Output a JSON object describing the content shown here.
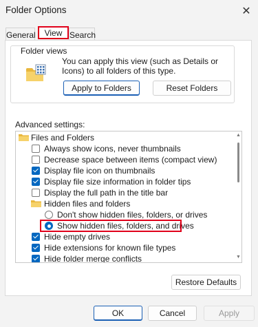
{
  "window": {
    "title": "Folder Options",
    "close_glyph": "✕"
  },
  "tabs": [
    {
      "label": "General"
    },
    {
      "label": "View"
    },
    {
      "label": "Search"
    }
  ],
  "folder_views": {
    "legend": "Folder views",
    "description": "You can apply this view (such as Details or Icons) to all folders of this type.",
    "apply_button": "Apply to Folders",
    "reset_button": "Reset Folders"
  },
  "advanced": {
    "label": "Advanced settings:",
    "items": [
      {
        "type": "folder",
        "label": "Files and Folders"
      },
      {
        "type": "checkbox",
        "checked": false,
        "label": "Always show icons, never thumbnails"
      },
      {
        "type": "checkbox",
        "checked": false,
        "label": "Decrease space between items (compact view)"
      },
      {
        "type": "checkbox",
        "checked": true,
        "label": "Display file icon on thumbnails"
      },
      {
        "type": "checkbox",
        "checked": true,
        "label": "Display file size information in folder tips"
      },
      {
        "type": "checkbox",
        "checked": false,
        "label": "Display the full path in the title bar"
      },
      {
        "type": "folder",
        "label": "Hidden files and folders"
      },
      {
        "type": "radio",
        "checked": false,
        "label": "Don't show hidden files, folders, or drives"
      },
      {
        "type": "radio",
        "checked": true,
        "label": "Show hidden files, folders, and drives"
      },
      {
        "type": "checkbox",
        "checked": true,
        "label": "Hide empty drives"
      },
      {
        "type": "checkbox",
        "checked": true,
        "label": "Hide extensions for known file types"
      },
      {
        "type": "checkbox",
        "checked": true,
        "label": "Hide folder merge conflicts"
      }
    ]
  },
  "restore_button": "Restore Defaults",
  "footer": {
    "ok": "OK",
    "cancel": "Cancel",
    "apply": "Apply"
  },
  "colors": {
    "accent": "#0067c0",
    "highlight": "#e0001a",
    "folder": "#f3c94f"
  }
}
